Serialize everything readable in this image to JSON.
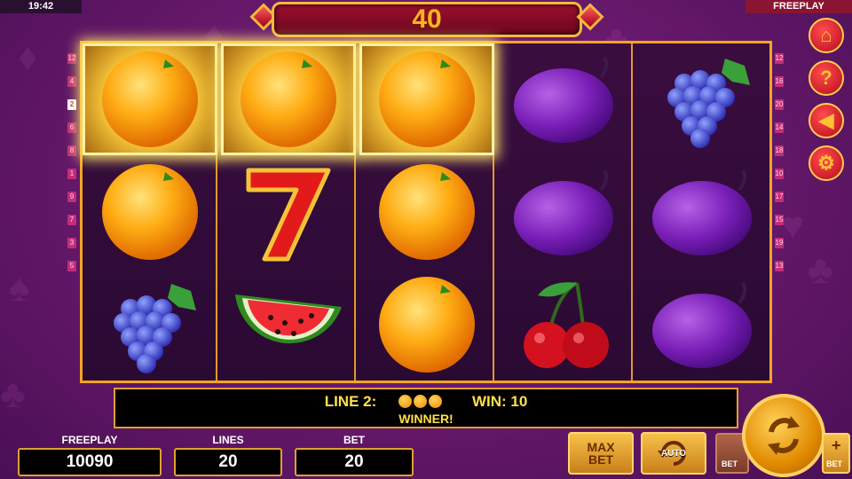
{
  "status": {
    "time": "19:42",
    "mode": "FREEPLAY"
  },
  "jackpot": {
    "value": "40"
  },
  "paylines": {
    "left": [
      "12",
      "4",
      "2",
      "6",
      "8",
      "1",
      "9",
      "7",
      "3",
      "5"
    ],
    "right": [
      "12",
      "16",
      "20",
      "14",
      "18",
      "10",
      "17",
      "15",
      "19",
      "13"
    ],
    "active": "2"
  },
  "reels": [
    [
      "orange",
      "orange",
      "grapes"
    ],
    [
      "orange",
      "seven",
      "watermelon"
    ],
    [
      "orange",
      "orange",
      "orange"
    ],
    [
      "plum",
      "plum",
      "cherries"
    ],
    [
      "grapes",
      "plum",
      "plum"
    ]
  ],
  "winning_cells": [
    [
      0,
      0
    ],
    [
      1,
      0
    ],
    [
      2,
      0
    ]
  ],
  "side_buttons": [
    {
      "name": "home-icon",
      "glyph": "⌂"
    },
    {
      "name": "help-icon",
      "glyph": "?"
    },
    {
      "name": "sound-off-icon",
      "glyph": "◀"
    },
    {
      "name": "settings-icon",
      "glyph": "⚙"
    }
  ],
  "message": {
    "line_label": "LINE 2:",
    "win_label": "WIN: 10",
    "status": "WINNER!"
  },
  "bottom": {
    "freeplay_label": "FREEPLAY",
    "freeplay_value": "10090",
    "lines_label": "LINES",
    "lines_value": "20",
    "bet_label": "BET",
    "bet_value": "20",
    "max_bet": "MAX BET",
    "auto": "AUTO",
    "bet_minus": "BET",
    "bet_plus": "BET",
    "plus_glyph": "+"
  },
  "colors": {
    "background": "#6b1a6e",
    "gold": "#f5a424",
    "text_yellow": "#ffe04a"
  }
}
